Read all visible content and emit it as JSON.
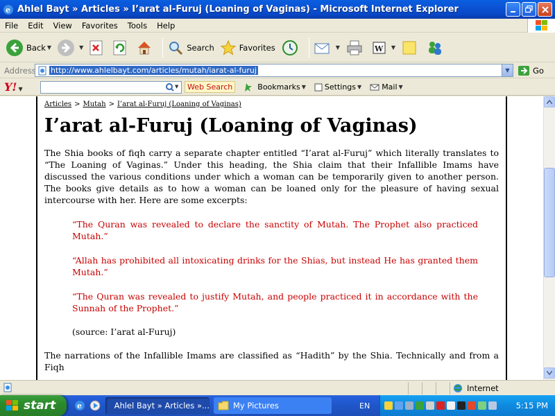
{
  "window": {
    "title": "Ahlel Bayt » Articles » I’arat al-Furuj (Loaning of Vaginas) - Microsoft Internet Explorer"
  },
  "menu": [
    "File",
    "Edit",
    "View",
    "Favorites",
    "Tools",
    "Help"
  ],
  "toolbar": {
    "back_label": "Back",
    "search_label": "Search",
    "favorites_label": "Favorites"
  },
  "address": {
    "label": "Address",
    "url": "http://www.ahlelbayt.com/articles/mutah/iarat-al-furuj",
    "go_label": "Go"
  },
  "yahoo": {
    "logo": "Y!",
    "web_search_label": "Web Search",
    "bookmarks_label": "Bookmarks",
    "settings_label": "Settings",
    "mail_label": "Mail"
  },
  "page": {
    "breadcrumb": [
      "Articles",
      "Mutah",
      "I’arat al-Furuj (Loaning of Vaginas)"
    ],
    "breadcrumb_sep": ">",
    "heading": "I’arat al-Furuj (Loaning of Vaginas)",
    "intro": "The Shia books of fiqh carry a separate chapter entitled “I’arat al-Furuj” which literally translates to “The Loaning of Vaginas.” Under this heading, the Shia claim that their Infallible Imams have discussed the various conditions under which a woman can be temporarily given to another person. The books give details as to how a woman can be loaned only for the pleasure of having sexual intercourse with her. Here are some excerpts:",
    "quotes": [
      "“The Quran was revealed to declare the sanctity of Mutah. The Prophet also practiced Mutah.”",
      "“Allah has prohibited all intoxicating drinks for the Shias, but instead He has granted them Mutah.”",
      "“The Quran was revealed to justify Mutah, and people practiced it in accordance with the Sunnah of the Prophet.”"
    ],
    "source": "(source: I’arat al-Furuj)",
    "tail": "The narrations of the Infallible Imams are classified as “Hadith” by the Shia. Technically and from a Fiqh"
  },
  "status": {
    "zone": "Internet"
  },
  "taskbar": {
    "start_label": "start",
    "tasks": [
      "Ahlel Bayt » Articles »...",
      "My Pictures"
    ],
    "language": "EN",
    "clock": "5:15 PM"
  },
  "colors": {
    "quote": "#C80000",
    "titlebar": "#0A5FE0",
    "taskbar": "#245EDB"
  }
}
